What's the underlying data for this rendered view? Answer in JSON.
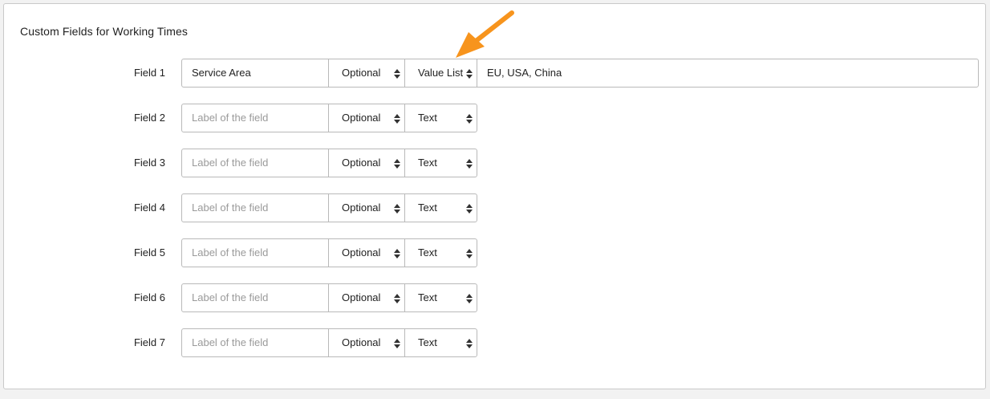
{
  "panel": {
    "title": "Custom Fields for Working Times"
  },
  "fields": [
    {
      "label": "Field 1",
      "name": "Service Area",
      "placeholder": "Label of the field",
      "required": "Optional",
      "type": "Value List",
      "values": "EU, USA, China"
    },
    {
      "label": "Field 2",
      "name": "",
      "placeholder": "Label of the field",
      "required": "Optional",
      "type": "Text"
    },
    {
      "label": "Field 3",
      "name": "",
      "placeholder": "Label of the field",
      "required": "Optional",
      "type": "Text"
    },
    {
      "label": "Field 4",
      "name": "",
      "placeholder": "Label of the field",
      "required": "Optional",
      "type": "Text"
    },
    {
      "label": "Field 5",
      "name": "",
      "placeholder": "Label of the field",
      "required": "Optional",
      "type": "Text"
    },
    {
      "label": "Field 6",
      "name": "",
      "placeholder": "Label of the field",
      "required": "Optional",
      "type": "Text"
    },
    {
      "label": "Field 7",
      "name": "",
      "placeholder": "Label of the field",
      "required": "Optional",
      "type": "Text"
    }
  ],
  "colors": {
    "annotation_arrow": "#f7941d",
    "border": "#b9b9b9",
    "placeholder": "#9a9a9a"
  },
  "icons": {
    "select_caret": "sort-caret-icon",
    "annotation": "arrow-annotation-icon"
  }
}
